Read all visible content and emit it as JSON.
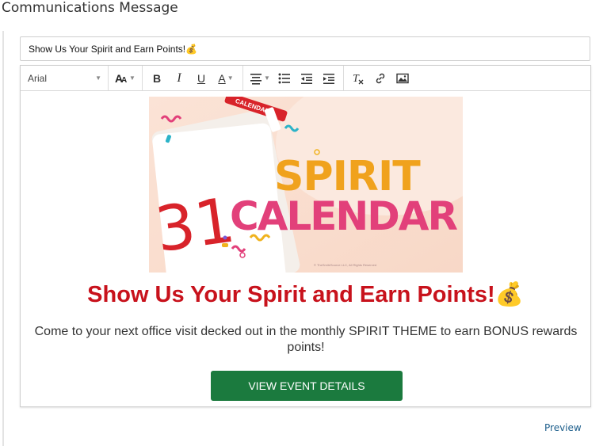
{
  "page": {
    "title": "Communications Message"
  },
  "subject": {
    "value": "Show Us Your Spirit and Earn Points!💰"
  },
  "toolbar": {
    "font_family": "Arial",
    "icons": [
      "font-size-icon",
      "bold-icon",
      "italic-icon",
      "underline-icon",
      "font-color-icon",
      "align-center-icon",
      "bulleted-list-icon",
      "outdent-icon",
      "indent-icon",
      "clear-format-icon",
      "link-icon",
      "image-icon"
    ]
  },
  "banner": {
    "word1": "SPIRIT",
    "word2": "CALENDAR",
    "tab_text": "CALENDAR",
    "number": "31",
    "copyright": "© TheSmileSource LLC, All Rights Reserved"
  },
  "content": {
    "headline": "Show Us Your Spirit and Earn Points!💰",
    "body": "Come to your next office visit decked out in the monthly SPIRIT THEME to earn BONUS rewards points!",
    "cta_label": "VIEW EVENT DETAILS"
  },
  "footer": {
    "preview_label": "Preview"
  },
  "colors": {
    "headline": "#c8121c",
    "cta": "#1b7a3e",
    "link": "#1e5f8c"
  }
}
